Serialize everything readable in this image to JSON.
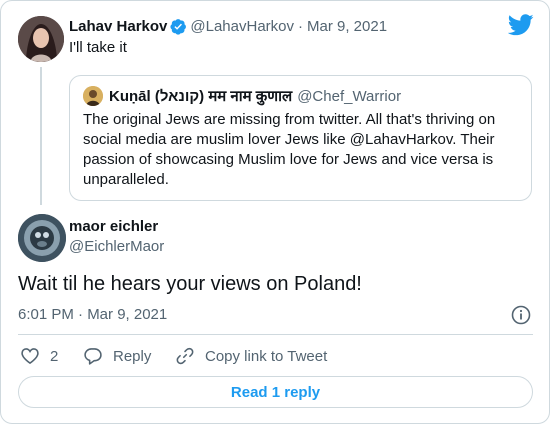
{
  "original_tweet": {
    "author_name": "Lahav Harkov",
    "handle": "@LahavHarkov",
    "separator": "·",
    "date": "Mar 9, 2021",
    "text": "I'll take it"
  },
  "quoted_tweet": {
    "author_name": "Kuṇāl (קונאל) मम नाम कुणाल",
    "handle": "@Chef_Warrior",
    "text_before_mention": "The original Jews are missing from twitter. All that's thriving on social media are muslim lover Jews like ",
    "mention": "@LahavHarkov",
    "text_after_mention": ". Their passion of showcasing Muslim love for Jews and vice versa is unparalleled."
  },
  "reply_tweet": {
    "author_name": "maor eichler",
    "handle": "@EichlerMaor",
    "text": "Wait til he hears your views on Poland!",
    "timestamp": "6:01 PM · Mar 9, 2021"
  },
  "actions": {
    "like_count": "2",
    "reply_label": "Reply",
    "copy_link_label": "Copy link to Tweet"
  },
  "read_replies_label": "Read 1 reply",
  "colors": {
    "accent": "#1d9bf0",
    "muted": "#536471",
    "border": "#cfd9de"
  },
  "icons": [
    "twitter-logo-icon",
    "verified-badge-icon",
    "info-icon",
    "heart-icon",
    "reply-bubble-icon",
    "link-icon"
  ]
}
